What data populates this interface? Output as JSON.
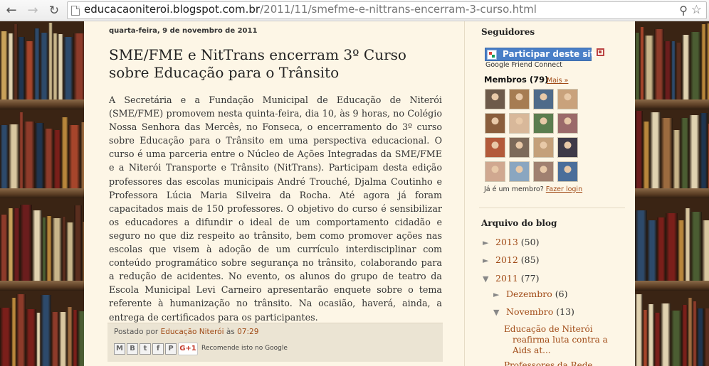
{
  "browser": {
    "url_host": "educacaoniteroi.blogspot.com.br",
    "url_path": "/2011/11/smefme-e-nittrans-encerram-3-curso.html"
  },
  "post": {
    "date": "quarta-feira, 9 de novembro de 2011",
    "title": "SME/FME e NitTrans encerram 3º Curso sobre Educação para o Trânsito",
    "body": "A Secretária e a Fundação Municipal de Educação de Niterói (SME/FME) promovem nesta quinta-feira, dia 10, às 9 horas, no Colégio Nossa Senhora das Mercês, no Fonseca, o encerramento do 3º curso sobre Educação para o Trânsito em uma perspectiva educacional. O curso é uma parceria entre o Núcleo de Ações Integradas da SME/FME e a Niterói Transporte e Trânsito (NitTrans). Participam desta edição professores das escolas municipais André Trouché, Djalma Coutinho e Professora Lúcia Maria Silveira da Rocha. Até agora já foram capacitados mais de 150 professores. O objetivo do curso é sensibilizar os educadores a difundir o ideal de um comportamento cidadão e seguro no que diz respeito ao trânsito, bem como promover ações nas escolas que visem à adoção de um currículo interdisciplinar com conteúdo programático sobre segurança no trânsito, colaborando para a redução de acidentes.  No evento, os alunos do grupo de teatro da Escola Municipal Levi Carneiro apresentarão enquete sobre o tema referente à humanização no trânsito. Na ocasião, haverá, ainda, a entrega de certificados para os participantes.",
    "footer": {
      "posted_by": "Postado por",
      "author": "Educação Niterói",
      "at": "às",
      "time": "07:29",
      "share_icons": [
        "email-icon",
        "blogthis-icon",
        "twitter-icon",
        "facebook-icon",
        "pinterest-icon"
      ],
      "gplus_label": "G+1",
      "gplus_text": "Recomende isto no Google"
    }
  },
  "sidebar": {
    "followers": {
      "heading": "Seguidores",
      "join_button": "Participar deste site",
      "caption": "Google Friend Connect",
      "members_label": "Membros (79)",
      "more_link": "Mais »",
      "question": "Já é um membro?",
      "login_link": "Fazer login"
    },
    "archive": {
      "heading": "Arquivo do blog",
      "years": [
        {
          "toggle": "►",
          "label": "2013",
          "count": "(50)"
        },
        {
          "toggle": "►",
          "label": "2012",
          "count": "(85)"
        },
        {
          "toggle": "▼",
          "label": "2011",
          "count": "(77)"
        }
      ],
      "months": [
        {
          "toggle": "►",
          "label": "Dezembro",
          "count": "(6)"
        },
        {
          "toggle": "▼",
          "label": "Novembro",
          "count": "(13)"
        }
      ],
      "posts": [
        "Educação de Niterói reafirma luta contra a Aids at...",
        "Professores da Rede..."
      ]
    }
  },
  "colors": {
    "link": "#a04a16",
    "page_bg": "#fdf6e6",
    "join_button": "#4a7fc7"
  }
}
